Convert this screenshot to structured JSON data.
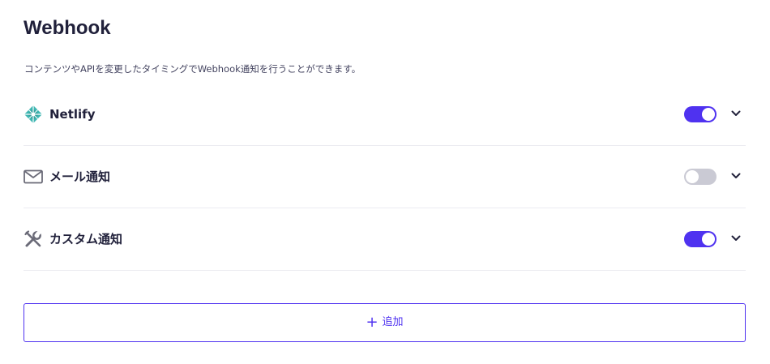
{
  "page": {
    "title": "Webhook",
    "description": "コンテンツやAPIを変更したタイミングでWebhook通知を行うことができます。"
  },
  "hooks": [
    {
      "name": "Netlify",
      "icon": "netlify-icon",
      "enabled": true
    },
    {
      "name": "メール通知",
      "icon": "mail-icon",
      "enabled": false
    },
    {
      "name": "カスタム通知",
      "icon": "tools-icon",
      "enabled": true
    }
  ],
  "add_button": {
    "icon": "+",
    "label": "追加"
  },
  "colors": {
    "accent": "#4f32f0",
    "toggle_off": "#cacad4",
    "text": "#21213b",
    "netlify": "#3fb6b2",
    "icon_gray": "#6b6b78"
  }
}
